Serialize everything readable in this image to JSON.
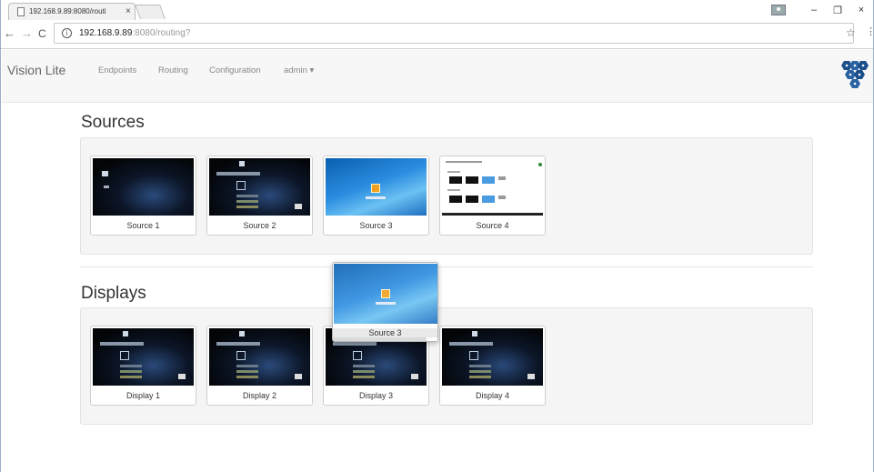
{
  "browser": {
    "tab_title": "192.168.9.89:8080/routi",
    "tab_close": "×",
    "url_host": "192.168.9.89",
    "url_path": ":8080/routing?",
    "window_min": "–",
    "window_restore": "❐",
    "window_close": "×"
  },
  "navbar": {
    "brand": "Vision Lite",
    "links": [
      "Endpoints",
      "Routing",
      "Configuration",
      "admin ▾"
    ]
  },
  "sources": {
    "title": "Sources",
    "items": [
      "Source 1",
      "Source 2",
      "Source 3",
      "Source 4"
    ]
  },
  "displays": {
    "title": "Displays",
    "items": [
      "Display 1",
      "Display 2",
      "Display 3",
      "Display 4"
    ]
  },
  "drag_ghost": {
    "label": "Source 3"
  },
  "colors": {
    "accent_logo": "#1a4f8a",
    "well_bg": "#f5f5f5"
  }
}
